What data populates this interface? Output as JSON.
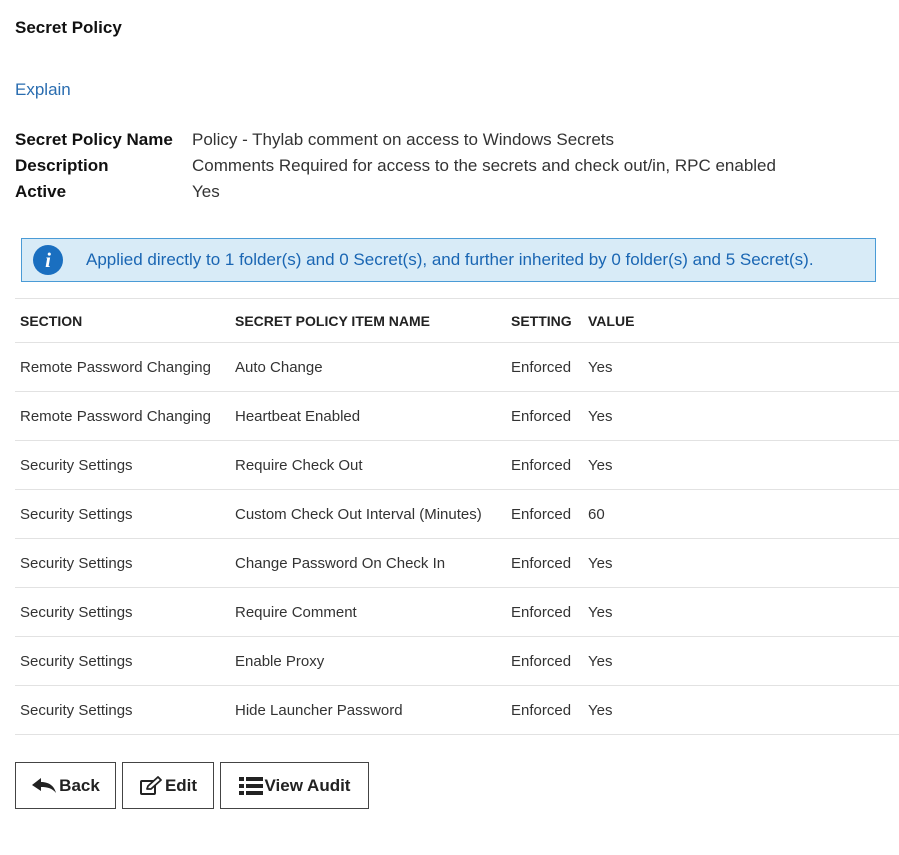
{
  "page": {
    "title": "Secret Policy",
    "explain_label": "Explain"
  },
  "details": {
    "name_label": "Secret Policy Name",
    "name_value": "Policy - Thylab comment on access to Windows Secrets",
    "description_label": "Description",
    "description_value": "Comments Required for access to the secrets and check out/in, RPC enabled",
    "active_label": "Active",
    "active_value": "Yes"
  },
  "info_banner": {
    "icon": "info-icon",
    "text": "Applied directly to 1 folder(s) and 0 Secret(s), and further inherited by 0 folder(s) and 5 Secret(s)."
  },
  "table": {
    "headers": [
      "SECTION",
      "SECRET POLICY ITEM NAME",
      "SETTING",
      "VALUE"
    ],
    "rows": [
      [
        "Remote Password Changing",
        "Auto Change",
        "Enforced",
        "Yes"
      ],
      [
        "Remote Password Changing",
        "Heartbeat Enabled",
        "Enforced",
        "Yes"
      ],
      [
        "Security Settings",
        "Require Check Out",
        "Enforced",
        "Yes"
      ],
      [
        "Security Settings",
        "Custom Check Out Interval (Minutes)",
        "Enforced",
        "60"
      ],
      [
        "Security Settings",
        "Change Password On Check In",
        "Enforced",
        "Yes"
      ],
      [
        "Security Settings",
        "Require Comment",
        "Enforced",
        "Yes"
      ],
      [
        "Security Settings",
        "Enable Proxy",
        "Enforced",
        "Yes"
      ],
      [
        "Security Settings",
        "Hide Launcher Password",
        "Enforced",
        "Yes"
      ]
    ]
  },
  "buttons": {
    "back_label": "Back",
    "back_icon": "reply-arrow-icon",
    "edit_label": "Edit",
    "edit_icon": "edit-icon",
    "audit_label": "View Audit",
    "audit_icon": "list-icon"
  },
  "colors": {
    "link": "#2a6db0",
    "banner_bg": "#d8ebf7",
    "banner_border": "#4a9bd6",
    "banner_text": "#1a66b3",
    "info_icon": "#1a6fc0"
  }
}
